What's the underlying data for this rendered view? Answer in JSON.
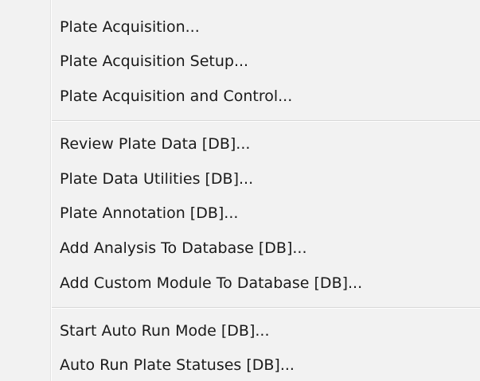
{
  "menu": {
    "groups": [
      {
        "items": [
          {
            "label": "Plate Acquisition..."
          },
          {
            "label": "Plate Acquisition Setup..."
          },
          {
            "label": "Plate Acquisition and Control..."
          }
        ]
      },
      {
        "items": [
          {
            "label": "Review Plate Data [DB]..."
          },
          {
            "label": "Plate Data Utilities [DB]..."
          },
          {
            "label": "Plate Annotation [DB]..."
          },
          {
            "label": "Add Analysis To Database [DB]..."
          },
          {
            "label": "Add Custom Module To Database [DB]..."
          }
        ]
      },
      {
        "items": [
          {
            "label": "Start Auto Run Mode [DB]..."
          },
          {
            "label": "Auto Run Plate Statuses [DB]..."
          }
        ]
      }
    ]
  },
  "colors": {
    "menu_background": "#f2f2f2",
    "separator": "#d7d7d7",
    "text": "#1a1a1a"
  }
}
